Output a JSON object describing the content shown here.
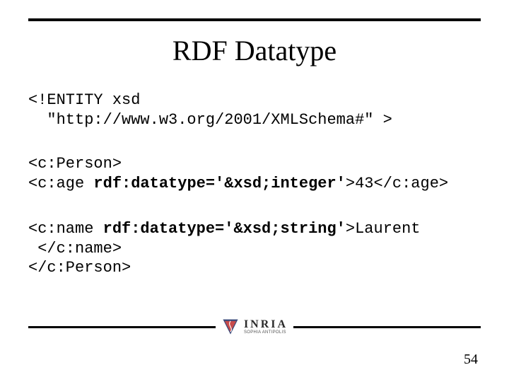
{
  "title": "RDF Datatype",
  "code": {
    "entity": {
      "open": "<!ENTITY xsd",
      "indent": "  \"http://www.w3.org/2001/XMLSchema#\" >"
    },
    "person_open": "<c:Person>",
    "age": {
      "pre": "<c:age ",
      "attr": "rdf:datatype='&xsd;integer'",
      "post": ">43</c:age>"
    },
    "name": {
      "pre": "<c:name ",
      "attr": "rdf:datatype='&xsd;string'",
      "post": ">Laurent"
    },
    "name_close": " </c:name>",
    "person_close": "</c:Person>"
  },
  "logo": {
    "name": "INRIA",
    "sub": "SOPHIA ANTIPOLIS"
  },
  "page_number": "54"
}
